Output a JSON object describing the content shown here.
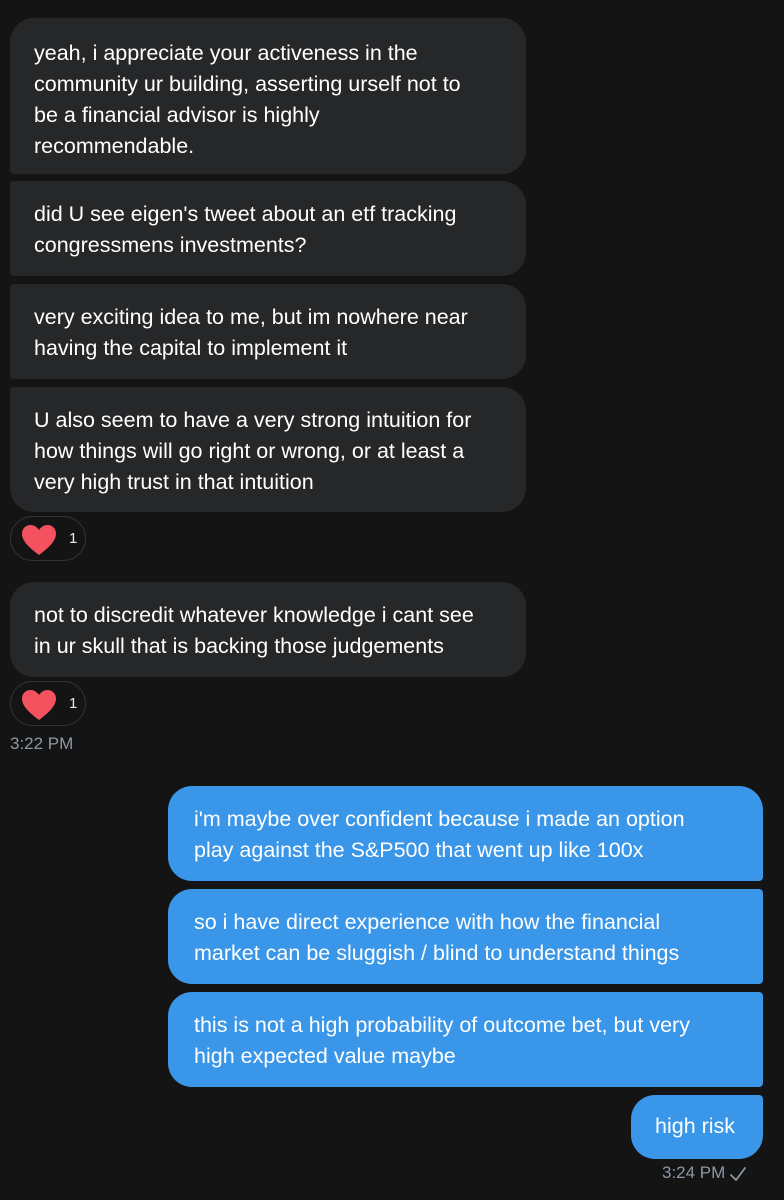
{
  "incoming_messages": [
    {
      "lines": [
        "yeah, i appreciate your activeness in the",
        "community ur building, asserting urself not to",
        "be a financial advisor is highly",
        "recommendable."
      ]
    },
    {
      "lines": [
        "did U see eigen's tweet about an etf tracking",
        "congressmens investments?"
      ]
    },
    {
      "lines": [
        "very exciting idea to me, but im nowhere near",
        "having the capital to implement it"
      ]
    },
    {
      "lines": [
        "U also seem to have a very strong intuition for",
        "how things will go right or wrong, or at least a",
        "very high trust in that intuition"
      ]
    },
    {
      "lines": [
        "not to discredit whatever knowledge i cant see",
        "in ur skull that is backing those judgements"
      ]
    }
  ],
  "reactions": [
    {
      "emoji": "heart-icon",
      "count": "1"
    },
    {
      "emoji": "heart-icon",
      "count": "1"
    }
  ],
  "timestamps": {
    "incoming": "3:22 PM",
    "outgoing": "3:24 PM"
  },
  "outgoing_messages": [
    {
      "lines": [
        "i'm maybe over confident because i made an option",
        "play against the S&P500 that went up like 100x"
      ]
    },
    {
      "lines": [
        "so i have direct experience with how the financial",
        "market can be sluggish / blind to understand things"
      ]
    },
    {
      "lines": [
        "this is not a high probability of outcome bet, but very",
        "high expected value maybe"
      ]
    },
    {
      "lines": [
        "high risk"
      ]
    }
  ],
  "colors": {
    "background": "#141414",
    "incoming_bubble": "#262729",
    "outgoing_bubble": "#3a96e8",
    "heart": "#f4525e",
    "timestamp": "#8b98a5"
  }
}
